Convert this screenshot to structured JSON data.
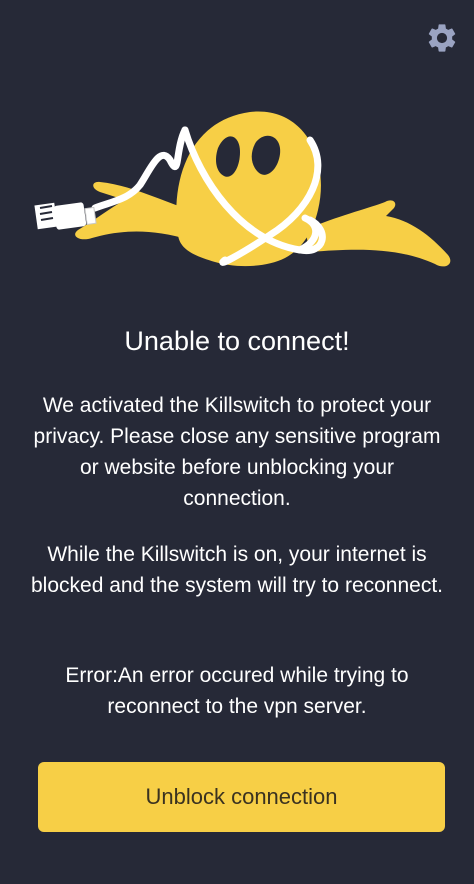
{
  "header": {
    "settings_icon": "gear-icon"
  },
  "illustration": {
    "icon": "ghost-tangled-cable-illustration",
    "colors": {
      "ghost": "#f7cf46",
      "cable": "#ffffff",
      "eyes": "#262937"
    }
  },
  "message": {
    "title": "Unable to connect!",
    "paragraph_1": "We activated the Killswitch to protect your privacy. Please close any sensitive program or website before unblocking your connection.",
    "paragraph_2": "While the Killswitch is on, your internet is blocked and the system will try to reconnect.",
    "error": "Error:An error occured while trying to reconnect to the vpn server."
  },
  "actions": {
    "unblock_label": "Unblock connection"
  },
  "theme": {
    "background": "#262937",
    "accent": "#f7cf46",
    "settings_icon_color": "#9aa3c2"
  }
}
